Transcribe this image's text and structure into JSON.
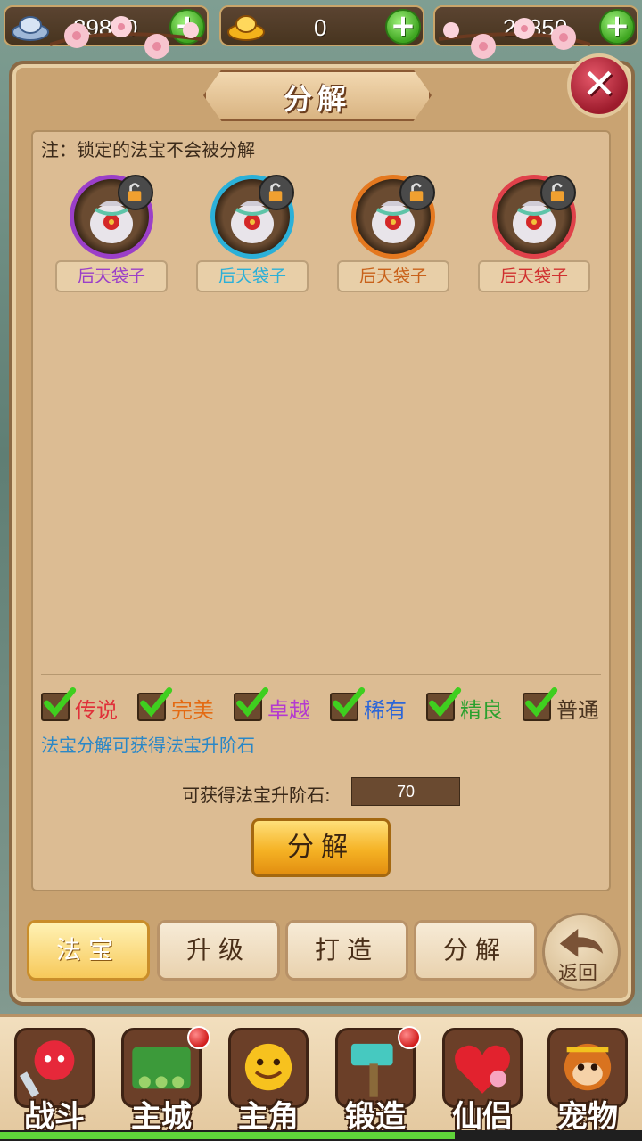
{
  "currency": {
    "silver": "29850",
    "gold": "0",
    "third": "29850"
  },
  "panel": {
    "title": "分解",
    "close_glyph": "✕",
    "note": "注：锁定的法宝不会被分解"
  },
  "items": [
    {
      "name": "后天袋子",
      "ring_color": "#9b3fc8",
      "text_color": "#9b3fc8"
    },
    {
      "name": "后天袋子",
      "ring_color": "#2bb0d8",
      "text_color": "#2bb0d8"
    },
    {
      "name": "后天袋子",
      "ring_color": "#e4781f",
      "text_color": "#c8611a"
    },
    {
      "name": "后天袋子",
      "ring_color": "#e0414a",
      "text_color": "#d0302f"
    }
  ],
  "filters": [
    {
      "label": "传说",
      "color": "#e0313a",
      "checked": true
    },
    {
      "label": "完美",
      "color": "#e46a12",
      "checked": true
    },
    {
      "label": "卓越",
      "color": "#b43ad0",
      "checked": true
    },
    {
      "label": "稀有",
      "color": "#2c66d8",
      "checked": true
    },
    {
      "label": "精良",
      "color": "#2aa12e",
      "checked": true
    },
    {
      "label": "普通",
      "color": "#4a3420",
      "checked": true
    }
  ],
  "hint": "法宝分解可获得法宝升阶石",
  "gain": {
    "label": "可获得法宝升阶石:",
    "value": "70"
  },
  "decompose_button": "分解",
  "tabs": [
    {
      "label": "法宝",
      "active": true
    },
    {
      "label": "升级",
      "active": false
    },
    {
      "label": "打造",
      "active": false
    },
    {
      "label": "分解",
      "active": false
    }
  ],
  "back_label": "返回",
  "nav": [
    {
      "label": "战斗",
      "icon": "battle-icon",
      "dot": false
    },
    {
      "label": "主城",
      "icon": "main-city-icon",
      "dot": true
    },
    {
      "label": "主角",
      "icon": "hero-icon",
      "dot": false
    },
    {
      "label": "锻造",
      "icon": "forge-hammer-icon",
      "dot": true
    },
    {
      "label": "仙侣",
      "icon": "companion-heart-icon",
      "dot": false
    },
    {
      "label": "宠物",
      "icon": "pet-monkey-icon",
      "dot": false
    }
  ]
}
